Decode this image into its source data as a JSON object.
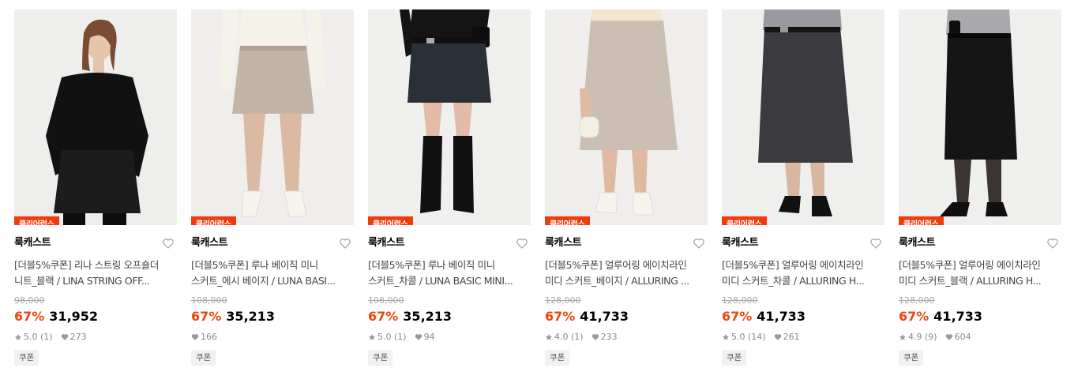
{
  "products": [
    {
      "badge": "클리어런스",
      "brand": "룩캐스트",
      "title_line1": "[더블5%쿠폰] 리나 스트링 오프숄더",
      "title_line2": "니트_블랙 / LINA STRING OFF...",
      "original_price": "98,000",
      "discount": "67%",
      "price": "31,952",
      "rating": "5.0 (1)",
      "likes": "273",
      "tag": "쿠폰",
      "photo": "black off-shoulder knit with black mini skirt"
    },
    {
      "badge": "클리어런스",
      "brand": "룩캐스트",
      "title_line1": "[더블5%쿠폰] 루나 베이직 미니",
      "title_line2": "스커트_에시 베이지 / LUNA BASI...",
      "original_price": "108,000",
      "discount": "67%",
      "price": "35,213",
      "rating": "",
      "likes": "166",
      "tag": "쿠폰",
      "photo": "beige mini skirt with white sandals"
    },
    {
      "badge": "클리어런스",
      "brand": "룩캐스트",
      "title_line1": "[더블5%쿠폰] 루나 베이직 미니",
      "title_line2": "스커트_차콜 / LUNA BASIC MINI...",
      "original_price": "108,000",
      "discount": "67%",
      "price": "35,213",
      "rating": "5.0 (1)",
      "likes": "94",
      "tag": "쿠폰",
      "photo": "charcoal mini skirt with black boots"
    },
    {
      "badge": "클리어런스",
      "brand": "룩캐스트",
      "title_line1": "[더블5%쿠폰] 얼루어링 에이치라인",
      "title_line2": "미디 스커트_베이지 / ALLURING ...",
      "original_price": "128,000",
      "discount": "67%",
      "price": "41,733",
      "rating": "4.0 (1)",
      "likes": "233",
      "tag": "쿠폰",
      "photo": "beige midi skirt with white bag"
    },
    {
      "badge": "클리어런스",
      "brand": "룩캐스트",
      "title_line1": "[더블5%쿠폰] 얼루어링 에이치라인",
      "title_line2": "미디 스커트_차콜 / ALLURING H...",
      "original_price": "128,000",
      "discount": "67%",
      "price": "41,733",
      "rating": "5.0 (14)",
      "likes": "261",
      "tag": "쿠폰",
      "photo": "charcoal midi skirt with belt"
    },
    {
      "badge": "클리어런스",
      "brand": "룩캐스트",
      "title_line1": "[더블5%쿠폰] 얼루어링 에이치라인",
      "title_line2": "미디 스커트_블랙 / ALLURING H...",
      "original_price": "128,000",
      "discount": "67%",
      "price": "41,733",
      "rating": "4.9 (9)",
      "likes": "604",
      "tag": "쿠폰",
      "photo": "black midi skirt with sheer tights"
    }
  ],
  "colors": {
    "badge": "#f03b0c",
    "discount": "#f0450f",
    "photo_bg": "#f1f0ef"
  }
}
